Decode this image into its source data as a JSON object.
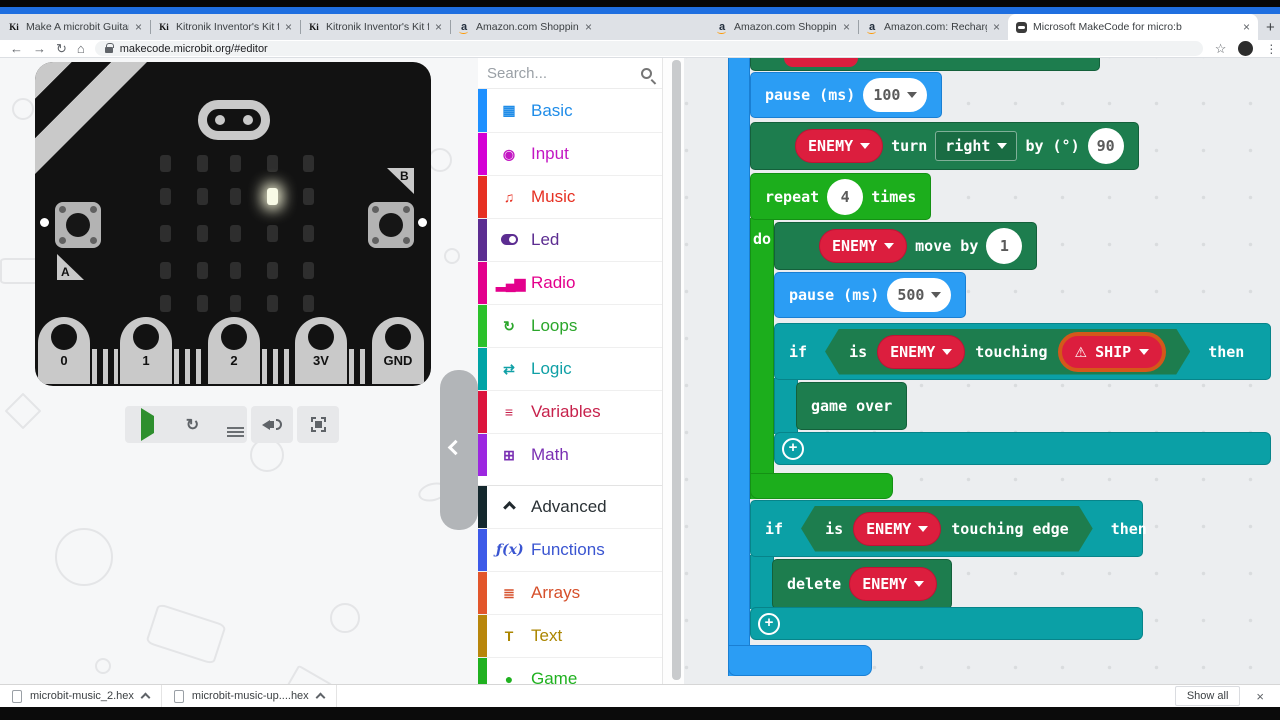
{
  "browser": {
    "tabs": [
      {
        "label": "Make A microbit Guitar With The",
        "favicon": "kitronik",
        "active": false
      },
      {
        "label": "Kitronik Inventor's Kit for the BB",
        "favicon": "kitronik",
        "active": false
      },
      {
        "label": "Kitronik Inventor's Kit for the BB",
        "favicon": "kitronik",
        "active": false
      },
      {
        "label": "Amazon.com Shopping Cart",
        "favicon": "amazon",
        "active": false
      },
      {
        "label": "Amazon.com Shopping Cart",
        "favicon": "amazon",
        "active": false
      },
      {
        "label": "Amazon.com: Rechargeable Wire",
        "favicon": "amazon",
        "active": false
      },
      {
        "label": "Microsoft MakeCode for micro:b",
        "favicon": "makecode",
        "active": true
      }
    ],
    "close_glyph": "×",
    "new_tab_glyph": "+",
    "minimize_glyph": "–",
    "close_window_glyph": "×",
    "back_glyph": "←",
    "forward_glyph": "→",
    "reload_glyph": "↻",
    "home_glyph": "⌂",
    "star_glyph": "☆",
    "menu_glyph": "⋮",
    "url": "makecode.microbit.org/#editor"
  },
  "simulator": {
    "button_a": "A",
    "button_b": "B",
    "pins": [
      "0",
      "1",
      "2",
      "3V",
      "GND"
    ],
    "led_grid": [
      0,
      0,
      0,
      0,
      0,
      0,
      0,
      0,
      1,
      0,
      0,
      0,
      0,
      0,
      0,
      0,
      0,
      0,
      0,
      0,
      0,
      0,
      0,
      0,
      0
    ],
    "toolbar_icons": [
      "play",
      "restart",
      "debug",
      "sound",
      "fullscreen"
    ]
  },
  "toolbox": {
    "search_placeholder": "Search...",
    "categories": [
      {
        "name": "Basic",
        "color": "#1f8ce8",
        "strip": "#1e90ff",
        "icon": "grid"
      },
      {
        "name": "Input",
        "color": "#c317c3",
        "strip": "#d400d4",
        "icon": "target"
      },
      {
        "name": "Music",
        "color": "#e63022",
        "strip": "#e63022",
        "icon": "music"
      },
      {
        "name": "Led",
        "color": "#5c2d91",
        "strip": "#5c2d91",
        "icon": "led"
      },
      {
        "name": "Radio",
        "color": "#e3008c",
        "strip": "#e3008c",
        "icon": "radio"
      },
      {
        "name": "Loops",
        "color": "#2ba62b",
        "strip": "#2bc12b",
        "icon": "loop"
      },
      {
        "name": "Logic",
        "color": "#10a0a6",
        "strip": "#00a4a6",
        "icon": "logic"
      },
      {
        "name": "Variables",
        "color": "#c7224c",
        "strip": "#dc143c",
        "icon": "vars"
      },
      {
        "name": "Math",
        "color": "#7a2fb3",
        "strip": "#9c27e0",
        "icon": "math"
      },
      {
        "name": "Advanced",
        "color": "#2a3135",
        "strip": "#14282e",
        "icon": "chevron-up",
        "separator_before": true
      },
      {
        "name": "Functions",
        "color": "#3a55d1",
        "strip": "#3d5ae8",
        "icon": "fx"
      },
      {
        "name": "Arrays",
        "color": "#d6502b",
        "strip": "#e2562b",
        "icon": "list"
      },
      {
        "name": "Text",
        "color": "#ab8600",
        "strip": "#b8860b",
        "icon": "text"
      },
      {
        "name": "Game",
        "color": "#20b120",
        "strip": "#20b120",
        "icon": "dot"
      }
    ]
  },
  "workspace": {
    "pause1": {
      "label": "pause (ms)",
      "value": "100"
    },
    "turn": {
      "sprite": "ENEMY",
      "turn": "turn",
      "direction": "right",
      "by": "by (°)",
      "degrees": "90"
    },
    "repeat": {
      "repeat": "repeat",
      "count": "4",
      "times": "times",
      "do": "do"
    },
    "move": {
      "sprite": "ENEMY",
      "label": "move by",
      "value": "1"
    },
    "pause2": {
      "label": "pause (ms)",
      "value": "500"
    },
    "if_ship": {
      "if": "if",
      "is": "is",
      "sprite": "ENEMY",
      "touching": "touching",
      "target": "SHIP",
      "then": "then",
      "action": "game over"
    },
    "if_edge": {
      "if": "if",
      "is": "is",
      "sprite": "ENEMY",
      "touching": "touching edge",
      "then": "then",
      "delete": "delete",
      "sprite2": "ENEMY"
    }
  },
  "downloads": {
    "items": [
      {
        "name": "microbit-music_2.hex"
      },
      {
        "name": "microbit-music-up....hex"
      }
    ],
    "show_all": "Show all",
    "close_glyph": "×"
  },
  "colors": {
    "accent_blue": "#1f6fe0",
    "block_blue": "#2b9df4",
    "block_dark_green": "#1d7d4e",
    "block_bright_green": "#1cae1c",
    "block_teal": "#0ba0a6",
    "sprite_red": "#dc1e3e",
    "warning_orange": "#d4581a"
  }
}
